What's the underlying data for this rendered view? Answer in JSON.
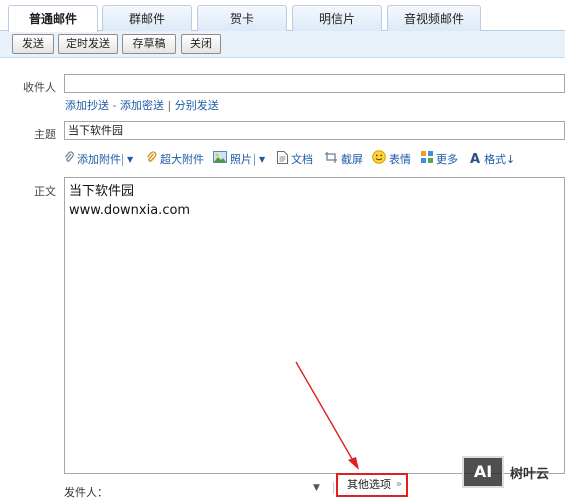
{
  "tabs": [
    "普通邮件",
    "群邮件",
    "贺卡",
    "明信片",
    "音视频邮件"
  ],
  "active_tab": 0,
  "toolbar": {
    "send": "发送",
    "scheduled_send": "定时发送",
    "save_draft": "存草稿",
    "close": "关闭"
  },
  "form": {
    "to_label": "收件人",
    "to_value": "",
    "add_cc": "添加抄送",
    "dash": "-",
    "add_bcc": "添加密送",
    "pipe": "|",
    "separate_send": "分别发送",
    "subject_label": "主题",
    "subject_value": "当下软件园",
    "body_label": "正文",
    "body_lines": [
      "当下软件园",
      "www.downxia.com"
    ]
  },
  "attach_bar": {
    "add_attachment": "添加附件",
    "large_attachment": "超大附件",
    "photo": "照片",
    "document": "文档",
    "screenshot": "截屏",
    "emoji": "表情",
    "more": "更多",
    "format": "格式↓"
  },
  "footer": {
    "sender_label": "发件人：",
    "other_options": "其他选项"
  },
  "watermark": {
    "logo_text": "AI",
    "brand": "树叶云"
  },
  "colors": {
    "link": "#1d5aa8",
    "highlight_red": "#e02020",
    "toolbar_bg": "#e9f1fb"
  }
}
